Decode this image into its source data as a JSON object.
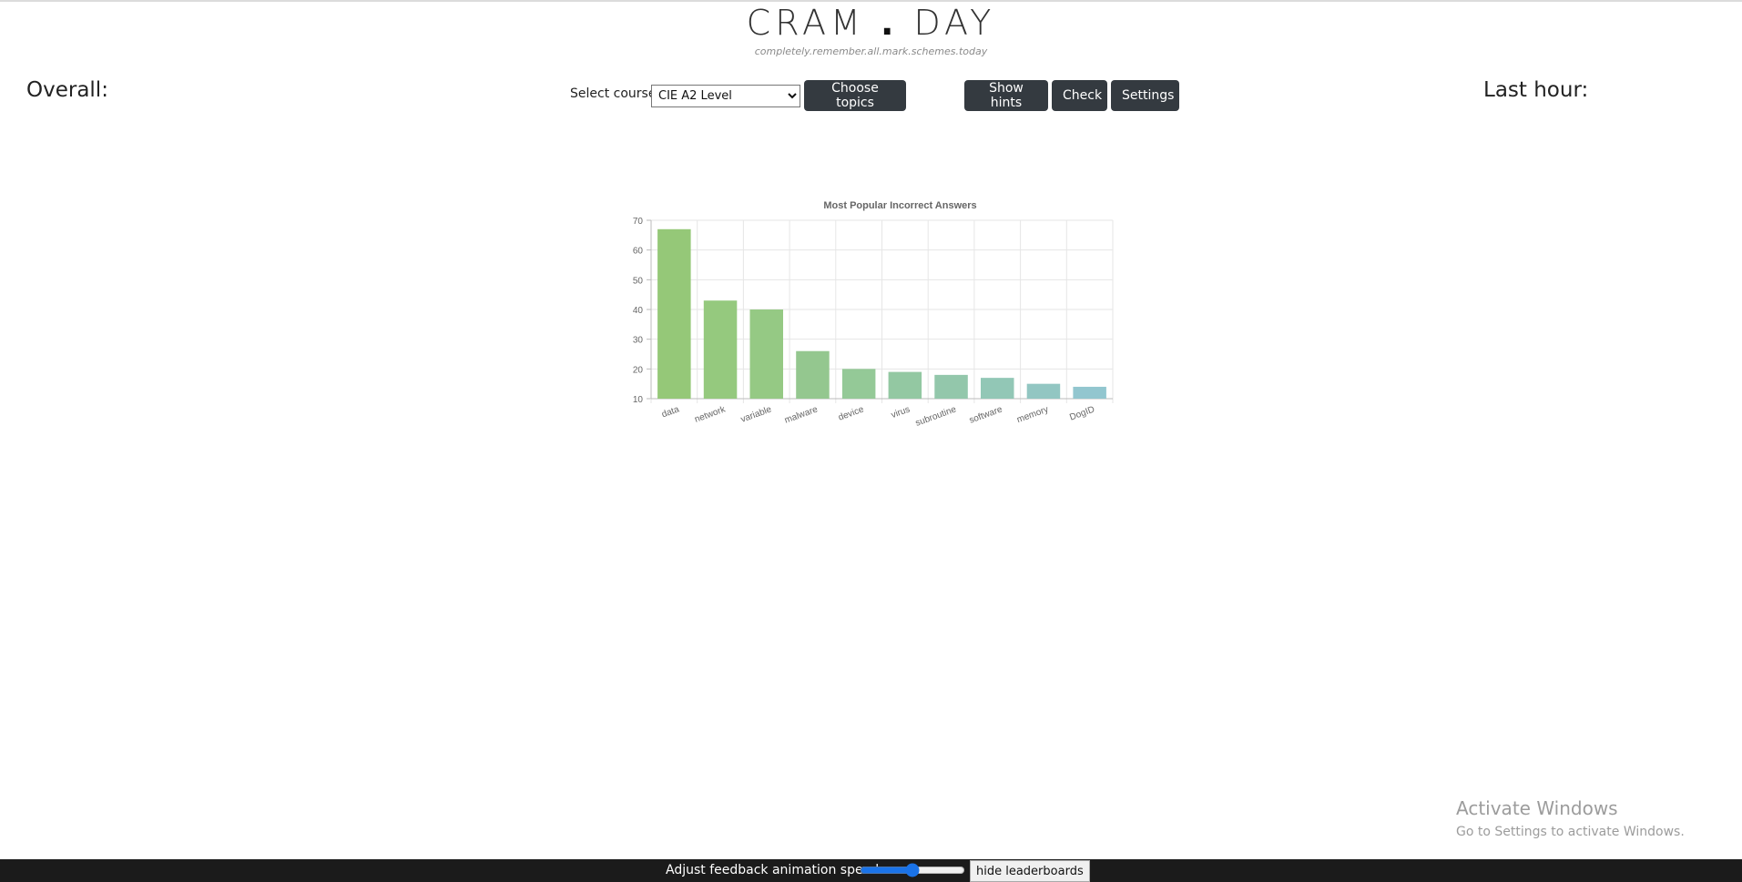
{
  "header": {
    "logo_left": "CRAM",
    "logo_dot": ".",
    "logo_right": "DAY",
    "tagline": "completely.remember.all.mark.schemes.today"
  },
  "stats": {
    "overall_label": "Overall:",
    "last_hour_label": "Last hour:"
  },
  "controls": {
    "course_label": "Select course:",
    "course_selected": "CIE A2 Level",
    "choose_topics": "Choose topics",
    "show_hints": "Show hints",
    "check": "Check",
    "settings": "Settings"
  },
  "chart_data": {
    "type": "bar",
    "title": "Most Popular Incorrect Answers",
    "categories": [
      "data",
      "network",
      "variable",
      "malware",
      "device",
      "virus",
      "subroutine",
      "software",
      "memory",
      "DogID"
    ],
    "values": [
      67,
      43,
      40,
      26,
      20,
      19,
      18,
      17,
      15,
      14
    ],
    "ylim": [
      10,
      70
    ],
    "yticks": [
      10,
      20,
      30,
      40,
      50,
      60,
      70
    ],
    "grid": true,
    "colors": [
      "#95c878",
      "#95c97e",
      "#95c984",
      "#94c78f",
      "#94c997",
      "#93c8a2",
      "#93c7ab",
      "#92c7b6",
      "#92c6c2",
      "#92c6cf"
    ]
  },
  "watermark": {
    "title": "Activate Windows",
    "subtitle": "Go to Settings to activate Windows."
  },
  "footer": {
    "speed_label": "Adjust feedback animation speed:",
    "speed_value": "50",
    "hide_leaderboards": "hide leaderboards"
  }
}
